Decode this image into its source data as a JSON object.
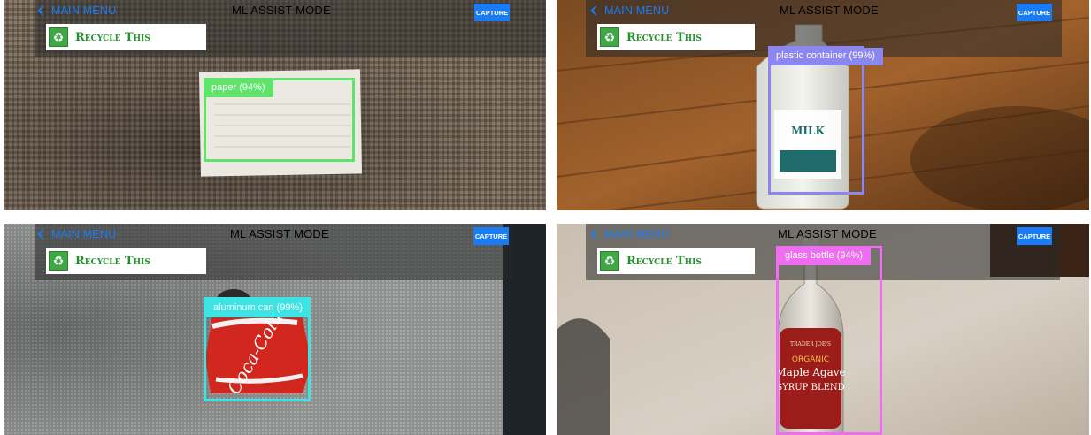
{
  "panels": [
    {
      "nav": {
        "back_label": "MAIN MENU"
      },
      "mode_title": "ML ASSIST MODE",
      "capture_label": "CAPTURE",
      "recycle_label": "Recycle This",
      "detection": {
        "label": "paper  (94%)",
        "color": "#5fe36b"
      }
    },
    {
      "nav": {
        "back_label": "MAIN MENU"
      },
      "mode_title": "ML ASSIST MODE",
      "capture_label": "CAPTURE",
      "recycle_label": "Recycle This",
      "detection": {
        "label": "plastic container  (99%)",
        "color": "#8c86ef"
      }
    },
    {
      "nav": {
        "back_label": "MAIN MENU"
      },
      "mode_title": "ML ASSIST MODE",
      "capture_label": "CAPTURE",
      "recycle_label": "Recycle This",
      "detection": {
        "label": "aluminum can  (99%)",
        "color": "#3ee3e3"
      }
    },
    {
      "nav": {
        "back_label": "MAIN MENU"
      },
      "mode_title": "ML ASSIST MODE",
      "capture_label": "CAPTURE",
      "recycle_label": "Recycle This",
      "detection": {
        "label": "glass bottle  (94%)",
        "color": "#ef6df0"
      }
    }
  ],
  "bottle_label": {
    "brand": "TRADER JOE'S",
    "line1": "ORGANIC",
    "line2": "Maple Agave",
    "line3": "SYRUP BLEND"
  },
  "jug_label": {
    "line1": "MILK"
  },
  "can_label": {
    "brand": "Coca-Cola"
  }
}
